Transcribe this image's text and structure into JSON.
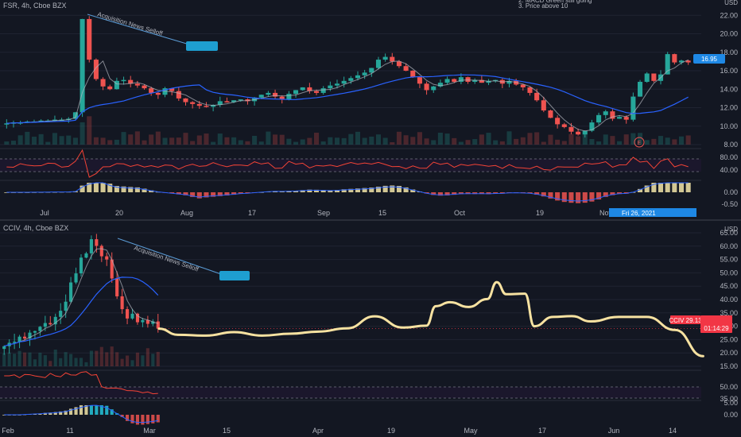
{
  "colors": {
    "background": "#131722",
    "grid": "#1f2331",
    "axis_text": "#b2b5be",
    "bull": "#26a69a",
    "bear": "#ef5350",
    "candle_neutral": "#c7c9d1",
    "ma_slow": "#2962ff",
    "ma_fast": "#b2b5be",
    "rsi_line": "#f44336",
    "rsi_band": "#7b1fa2",
    "macd_pos": "#f5e6a8",
    "macd_neg": "#ef5350",
    "macd_teal": "#26c6da",
    "forecast_path": "#f7e2a1",
    "annotation_line": "#5b9bd5",
    "label_box": "#1e9ed0",
    "price_tag": "#1e88e5",
    "price_tag_red": "#f23645",
    "event_marker": "#ef5350"
  },
  "chart_data": [
    {
      "type": "candlestick",
      "symbol": "FSR, 4h, Cboe BZX",
      "notes": [
        "2. MACD Green still going",
        "3. Price above 10"
      ],
      "currency": "USD",
      "y_ticks": [
        "22.00",
        "20.00",
        "18.00",
        "16.00",
        "14.00",
        "12.00",
        "10.00",
        "8.00"
      ],
      "x_ticks": [
        "Jul",
        "20",
        "Aug",
        "17",
        "Sep",
        "15",
        "Oct",
        "19",
        "Nov"
      ],
      "annotation": "Acquisition News Selloff",
      "price_label": "16.95",
      "crosshair_label": "Fri 26, 2021",
      "event_marker": "E",
      "close_series": [
        10.3,
        10.4,
        10.4,
        10.5,
        10.5,
        10.6,
        10.6,
        10.7,
        10.7,
        10.8,
        11.5,
        21.6,
        17.2,
        15.1,
        14.3,
        14.0,
        14.9,
        15.0,
        14.6,
        14.4,
        14.1,
        13.6,
        13.4,
        14.1,
        13.8,
        13.0,
        12.6,
        12.4,
        12.2,
        12.1,
        12.3,
        12.7,
        12.6,
        12.8,
        12.9,
        12.7,
        13.1,
        13.4,
        13.6,
        13.2,
        12.9,
        13.5,
        13.9,
        14.2,
        13.8,
        13.6,
        14.1,
        14.4,
        14.6,
        14.9,
        15.2,
        15.5,
        15.8,
        16.3,
        17.2,
        17.5,
        17.0,
        16.5,
        16.0,
        15.3,
        14.6,
        13.9,
        14.3,
        14.7,
        15.1,
        14.8,
        15.3,
        14.8,
        15.0,
        14.7,
        14.9,
        15.0,
        14.6,
        14.9,
        14.5,
        14.2,
        13.6,
        12.8,
        11.7,
        10.9,
        10.2,
        9.9,
        9.4,
        9.1,
        9.5,
        10.4,
        11.2,
        11.6,
        10.8,
        11.0,
        10.7,
        13.2,
        14.8,
        15.7,
        14.9,
        15.6,
        17.8,
        16.9,
        17.1,
        16.9
      ],
      "rsi_ticks": [
        "80.00",
        "40.00"
      ],
      "macd_ticks": [
        "0.00",
        "-0.50"
      ]
    },
    {
      "type": "candlestick",
      "symbol": "CCIV, 4h, Cboe BZX",
      "currency": "USD",
      "y_ticks": [
        "65.00",
        "60.00",
        "55.00",
        "50.00",
        "45.00",
        "40.00",
        "35.00",
        "30.00",
        "25.00",
        "20.00",
        "15.00"
      ],
      "x_ticks": [
        "Feb",
        "11",
        "Mar",
        "15",
        "Apr",
        "19",
        "May",
        "17",
        "Jun",
        "14"
      ],
      "annotation": "Acquisition News Selloff",
      "price_label": "CCIV  29.13",
      "countdown_label": "01:14:29",
      "close_series": [
        22.5,
        23.8,
        24.2,
        26.1,
        25.4,
        27.6,
        28.2,
        29.8,
        31.2,
        30.7,
        33.5,
        35.8,
        39.2,
        46.4,
        49.8,
        55.7,
        57.3,
        62.6,
        60.1,
        56.2,
        55.0,
        47.9,
        41.2,
        36.4,
        32.9,
        34.7,
        31.5,
        32.3,
        30.9,
        31.8,
        29.1
      ],
      "forecast_path": [
        [
          0,
          29.1
        ],
        [
          4,
          26.8
        ],
        [
          10,
          26.5
        ],
        [
          16,
          27.8
        ],
        [
          22,
          26.5
        ],
        [
          28,
          27.2
        ],
        [
          34,
          28.0
        ],
        [
          40,
          29.2
        ],
        [
          46,
          33.7
        ],
        [
          52,
          29.5
        ],
        [
          57,
          30.2
        ],
        [
          59,
          37.5
        ],
        [
          62,
          39.0
        ],
        [
          66,
          37.2
        ],
        [
          70,
          40.2
        ],
        [
          72,
          46.5
        ],
        [
          74,
          42.0
        ],
        [
          78,
          42.2
        ],
        [
          80,
          30.0
        ],
        [
          84,
          33.5
        ],
        [
          88,
          33.8
        ],
        [
          92,
          31.8
        ],
        [
          98,
          33.5
        ],
        [
          104,
          33.5
        ],
        [
          110,
          28.6
        ],
        [
          116,
          18.8
        ]
      ],
      "rsi_ticks": [
        "50.00",
        "35.00"
      ],
      "macd_ticks": [
        "5.00",
        "0.00"
      ]
    }
  ]
}
